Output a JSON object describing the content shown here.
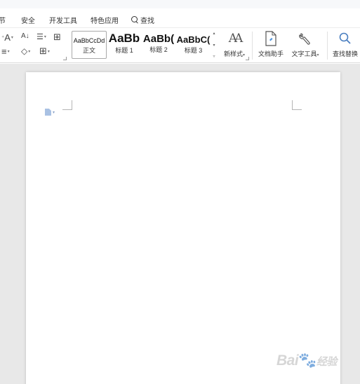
{
  "menubar": {
    "items": [
      "节",
      "安全",
      "开发工具",
      "特色应用",
      "查找"
    ]
  },
  "ribbon": {
    "small_tools": {
      "font_size_adjust": "A",
      "sort": "A↓",
      "line_spacing": "☰",
      "table_border": "⊞",
      "list": "≡",
      "shading": "◇",
      "borders": "⊞"
    },
    "styles": [
      {
        "sample": "AaBbCcDd",
        "label": "正文",
        "selected": true
      },
      {
        "sample": "AaBb",
        "label": "标题 1"
      },
      {
        "sample": "AaBb(",
        "label": "标题 2"
      },
      {
        "sample": "AaBbC(",
        "label": "标题 3"
      }
    ],
    "new_style": {
      "glyph": "AA",
      "label": "新样式"
    },
    "doc_assistant": {
      "label": "文档助手"
    },
    "text_tools": {
      "label": "文字工具"
    },
    "find_replace": {
      "label": "查找替换"
    }
  },
  "watermark": {
    "text": "Bai",
    "tail": "经验"
  },
  "colors": {
    "doc_background": "#e8e8e8",
    "page": "#ffffff",
    "accent_icon": "#a9c1e3"
  }
}
